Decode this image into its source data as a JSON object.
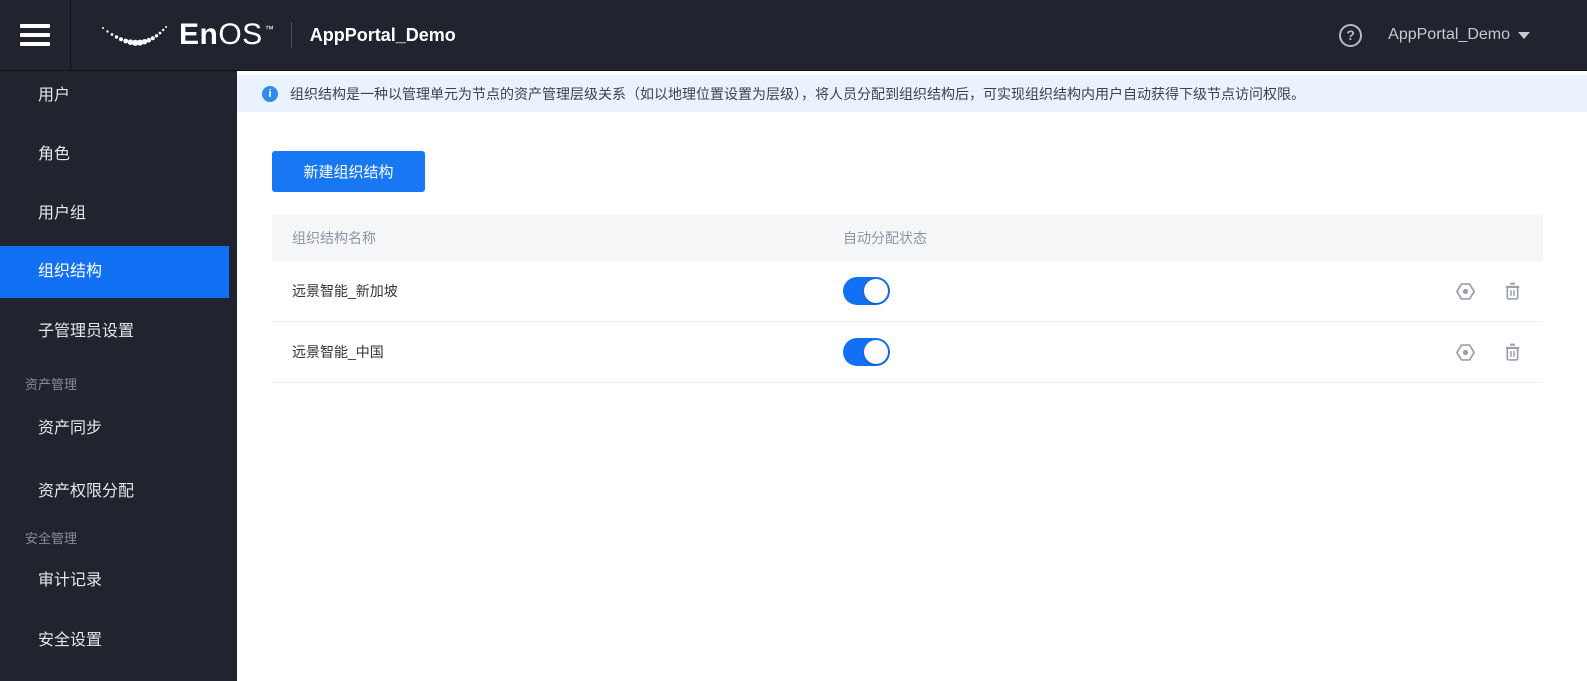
{
  "header": {
    "hamburger_icon": "hamburger-menu-icon",
    "logo_icon": "enos-dotted-swoosh-logo",
    "brand_bold": "En",
    "brand_light": "OS",
    "brand_tm": "™",
    "app_title": "AppPortal_Demo",
    "help_icon": "help-circle-icon",
    "help_glyph": "?",
    "account_label": "AppPortal_Demo",
    "account_caret_icon": "chevron-down-icon"
  },
  "sidebar": {
    "items": [
      {
        "label": "用户",
        "type": "item",
        "selected": false
      },
      {
        "label": "角色",
        "type": "item",
        "selected": false
      },
      {
        "label": "用户组",
        "type": "item",
        "selected": false
      },
      {
        "label": "组织结构",
        "type": "item",
        "selected": true
      },
      {
        "label": "子管理员设置",
        "type": "item",
        "selected": false
      },
      {
        "label": "资产管理",
        "type": "section"
      },
      {
        "label": "资产同步",
        "type": "item",
        "selected": false
      },
      {
        "label": "资产权限分配",
        "type": "item",
        "selected": false
      },
      {
        "label": "安全管理",
        "type": "section"
      },
      {
        "label": "审计记录",
        "type": "item",
        "selected": false
      },
      {
        "label": "安全设置",
        "type": "item",
        "selected": false
      }
    ]
  },
  "banner": {
    "icon": "info-icon",
    "icon_glyph": "i",
    "text": "组织结构是一种以管理单元为节点的资产管理层级关系（如以地理位置设置为层级），将人员分配到组织结构后，可实现组织结构内用户自动获得下级节点访问权限。"
  },
  "toolbar": {
    "create_button_label": "新建组织结构"
  },
  "table": {
    "columns": [
      {
        "label": "组织结构名称"
      },
      {
        "label": "自动分配状态"
      }
    ],
    "rows": [
      {
        "name": "远景智能_新加坡",
        "auto_assign_enabled": true
      },
      {
        "name": "远景智能_中国",
        "auto_assign_enabled": true
      }
    ],
    "row_action_icons": [
      "settings-nut-icon",
      "trash-icon"
    ]
  },
  "colors": {
    "header_sidebar_bg": "#21242e",
    "accent_blue": "#1270f4",
    "button_blue": "#1877f2",
    "banner_bg": "#e9f2fd",
    "info_icon_blue": "#2e8bf0",
    "table_header_bg": "#f5f6f8",
    "muted_text": "#8f95a0",
    "icon_gray": "#9aa1ad"
  }
}
